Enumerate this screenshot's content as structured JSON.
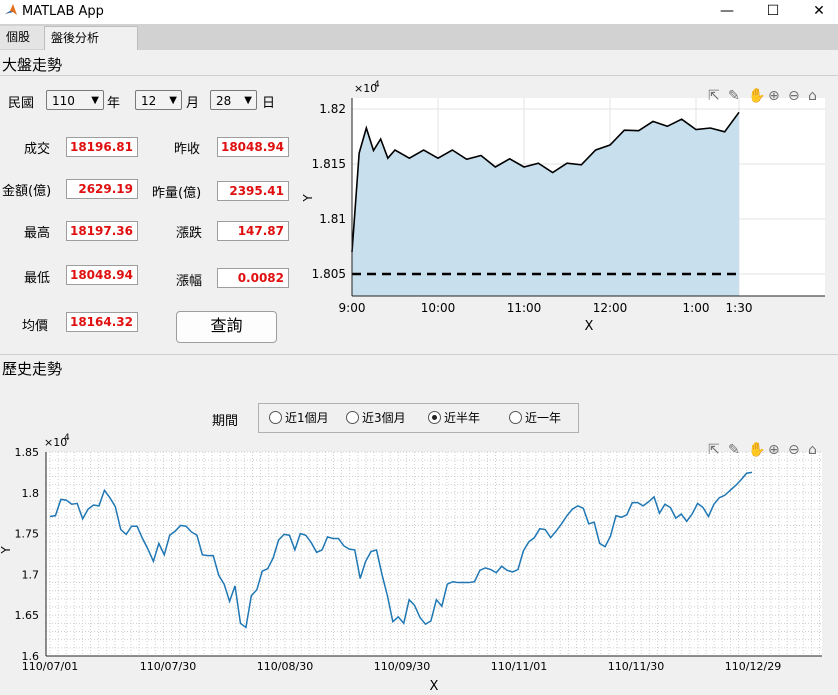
{
  "window": {
    "title": "MATLAB App",
    "minimize": "—",
    "maximize": "☐",
    "close": "✕"
  },
  "tabs": [
    {
      "label": "個股"
    },
    {
      "label": "盤後分析"
    }
  ],
  "section1": {
    "title": "大盤走勢"
  },
  "date": {
    "era_label": "民國",
    "year": "110",
    "year_unit": "年",
    "month": "12",
    "month_unit": "月",
    "day": "28",
    "day_unit": "日"
  },
  "stats": {
    "close_label": "成交",
    "close": "18196.81",
    "prev_close_label": "昨收",
    "prev_close": "18048.94",
    "amount_label": "金額(億)",
    "amount": "2629.19",
    "prev_amount_label": "昨量(億)",
    "prev_amount": "2395.41",
    "high_label": "最高",
    "high": "18197.36",
    "change_label": "漲跌",
    "change": "147.87",
    "low_label": "最低",
    "low": "18048.94",
    "pct_label": "漲幅",
    "pct": "0.0082",
    "avg_label": "均價",
    "avg": "18164.32"
  },
  "query_button": "查詢",
  "section2": {
    "title": "歷史走勢"
  },
  "period": {
    "label": "期間",
    "options": [
      "近1個月",
      "近3個月",
      "近半年",
      "近一年"
    ],
    "selected": "近半年"
  },
  "toolbar_icons": [
    "export-icon",
    "brush-icon",
    "pan-hand-icon",
    "zoom-in-icon",
    "zoom-out-icon",
    "home-icon"
  ],
  "colors": {
    "intraday_fill": "#c8dfee",
    "intraday_line": "#000000",
    "history_line": "#1f77b4",
    "value_text": "#e01010"
  },
  "chart_data": [
    {
      "type": "area",
      "exponent_label": "×10",
      "exponent": "4",
      "x_ticks": [
        "9:00",
        "10:00",
        "11:00",
        "12:00",
        "1:00",
        "1:30"
      ],
      "y_ticks": [
        "1.805",
        "1.81",
        "1.815",
        "1.82"
      ],
      "xlabel": "X",
      "ylabel": "Y",
      "ylim": [
        18030,
        18210
      ],
      "grid": true,
      "reference_line": {
        "value": 18050,
        "style": "dashed"
      },
      "x": [
        0,
        5,
        10,
        15,
        20,
        25,
        30,
        40,
        50,
        60,
        70,
        80,
        90,
        100,
        110,
        120,
        130,
        140,
        150,
        160,
        170,
        180,
        190,
        200,
        210,
        220,
        230,
        240,
        250,
        260,
        270
      ],
      "values": [
        18070,
        18160,
        18180,
        18165,
        18170,
        18158,
        18160,
        18158,
        18160,
        18158,
        18160,
        18157,
        18155,
        18150,
        18152,
        18150,
        18148,
        18145,
        18148,
        18152,
        18160,
        18170,
        18178,
        18183,
        18186,
        18187,
        18188,
        18184,
        18180,
        18182,
        18197
      ]
    },
    {
      "type": "line",
      "exponent_label": "×10",
      "exponent": "4",
      "x_ticks": [
        "110/07/01",
        "110/07/30",
        "110/08/30",
        "110/09/30",
        "110/11/01",
        "110/11/30",
        "110/12/29"
      ],
      "y_ticks": [
        "1.6",
        "1.65",
        "1.7",
        "1.75",
        "1.8",
        "1.85"
      ],
      "xlabel": "X",
      "ylabel": "Y",
      "ylim": [
        16000,
        18500
      ],
      "grid": true,
      "values": [
        17710,
        17720,
        17920,
        17910,
        17860,
        17870,
        17680,
        17800,
        17850,
        17840,
        18030,
        17940,
        17830,
        17550,
        17490,
        17590,
        17590,
        17440,
        17310,
        17160,
        17380,
        17240,
        17480,
        17530,
        17600,
        17590,
        17520,
        17480,
        17240,
        17230,
        17230,
        16990,
        16880,
        16670,
        16860,
        16400,
        16350,
        16740,
        16810,
        17040,
        17070,
        17200,
        17420,
        17490,
        17480,
        17300,
        17500,
        17480,
        17390,
        17270,
        17300,
        17460,
        17440,
        17440,
        17350,
        17310,
        17300,
        16950,
        17160,
        17280,
        17300,
        17000,
        16740,
        16420,
        16480,
        16400,
        16690,
        16620,
        16470,
        16390,
        16430,
        16690,
        16610,
        16880,
        16910,
        16900,
        16900,
        16900,
        16910,
        17050,
        17080,
        17060,
        17020,
        17100,
        17050,
        17030,
        17060,
        17290,
        17400,
        17450,
        17560,
        17550,
        17450,
        17530,
        17620,
        17720,
        17800,
        17840,
        17810,
        17620,
        17640,
        17380,
        17340,
        17470,
        17720,
        17700,
        17730,
        17880,
        17880,
        17840,
        17890,
        17950,
        17750,
        17860,
        17820,
        17690,
        17740,
        17650,
        17740,
        17870,
        17820,
        17710,
        17860,
        17940,
        17970,
        18030,
        18090,
        18160,
        18240,
        18250
      ]
    }
  ]
}
